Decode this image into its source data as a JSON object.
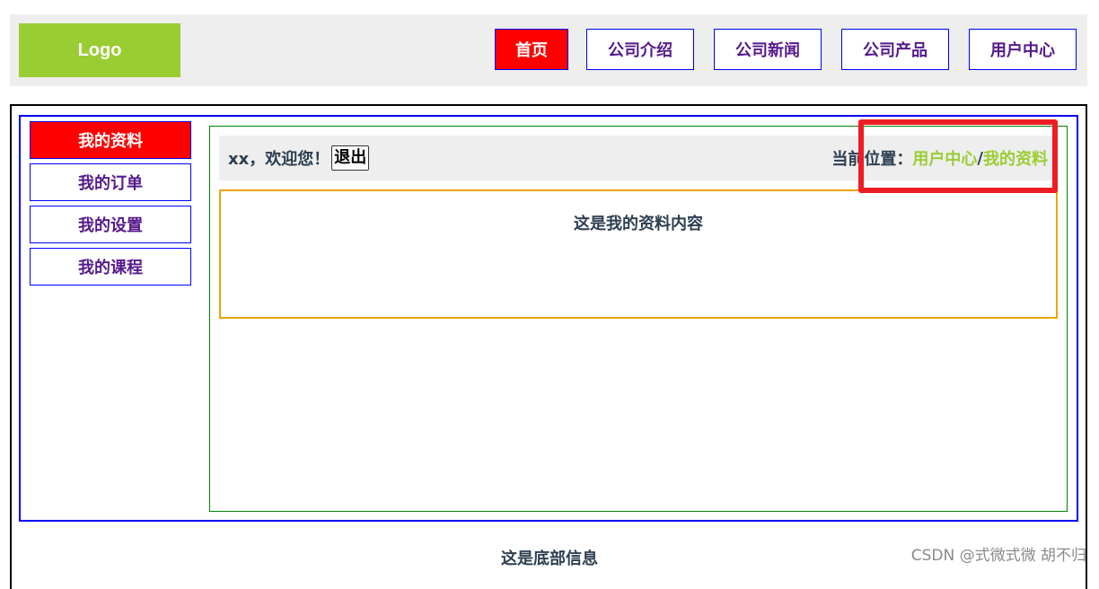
{
  "header": {
    "logo": "Logo",
    "nav": [
      {
        "label": "首页",
        "active": true
      },
      {
        "label": "公司介绍",
        "active": false
      },
      {
        "label": "公司新闻",
        "active": false
      },
      {
        "label": "公司产品",
        "active": false
      },
      {
        "label": "用户中心",
        "active": false
      }
    ]
  },
  "sidebar": {
    "items": [
      {
        "label": "我的资料",
        "active": true
      },
      {
        "label": "我的订单",
        "active": false
      },
      {
        "label": "我的设置",
        "active": false
      },
      {
        "label": "我的课程",
        "active": false
      }
    ]
  },
  "topbar": {
    "welcome": "xx，欢迎您！",
    "logout": "退出",
    "location_label": "当前位置：",
    "crumb_parent": "用户中心",
    "crumb_sep": "/",
    "crumb_current": "我的资料"
  },
  "main": {
    "profile_content": "这是我的资料内容"
  },
  "footer": {
    "text": "这是底部信息"
  },
  "watermark": "CSDN @式微式微    胡不归",
  "colors": {
    "accent_green": "#9acd32",
    "active_red": "#ff0000",
    "border_blue": "#0000ff",
    "link_purple": "#551a8b",
    "highlight_red": "#ee1c25"
  }
}
